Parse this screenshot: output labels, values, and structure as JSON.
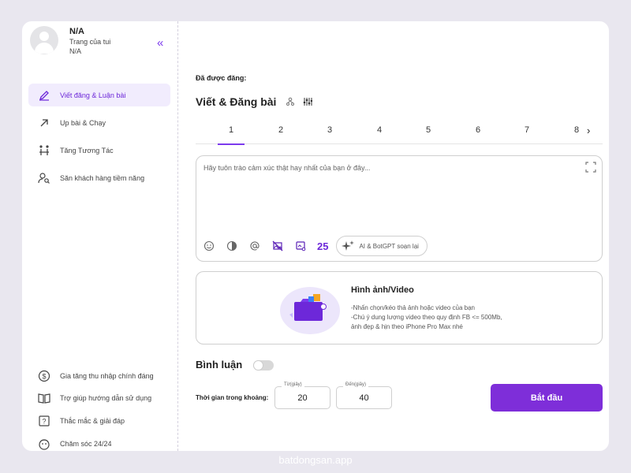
{
  "profile": {
    "name": "N/A",
    "subtitle": "Trang của tui",
    "id": "N/A"
  },
  "sidebar": {
    "items": [
      {
        "label": "Viết đăng & Luận bài",
        "icon": "pen-icon",
        "active": true
      },
      {
        "label": "Up bài & Chạy",
        "icon": "arrow-up-right-icon",
        "active": false
      },
      {
        "label": "Tăng Tương Tác",
        "icon": "interaction-icon",
        "active": false
      },
      {
        "label": "Săn khách hàng tiềm năng",
        "icon": "user-search-icon",
        "active": false
      }
    ],
    "bottom_items": [
      {
        "label": "Gia tăng thu nhập chính đáng",
        "icon": "dollar-icon"
      },
      {
        "label": "Trợ giúp hướng dẫn sử dụng",
        "icon": "book-icon"
      },
      {
        "label": "Thắc mắc & giải đáp",
        "icon": "question-icon"
      },
      {
        "label": "Chăm sóc 24/24",
        "icon": "support-icon"
      }
    ]
  },
  "main": {
    "posted_label": "Đã được đăng:",
    "title": "Viết & Đăng bài",
    "tabs": [
      "1",
      "2",
      "3",
      "4",
      "5",
      "6",
      "7",
      "8"
    ],
    "active_tab": "1",
    "editor": {
      "placeholder": "Hãy tuôn trào cảm xúc thật hay nhất của bạn ở đây...",
      "value": "",
      "count": "25",
      "ai_button": "AI & BotGPT soạn lại"
    },
    "media": {
      "title": "Hình ảnh/Video",
      "line1": "-Nhấn chọn/kéo thả ảnh hoặc video của bạn",
      "line2": "-Chú ý dung lượng video theo quy định FB <= 500Mb,",
      "line3": "ảnh đẹp & hịn theo iPhone Pro Max nhé"
    },
    "comment_label": "Bình luận",
    "comment_enabled": false,
    "time": {
      "label": "Thời gian trong khoảng:",
      "from_label": "Từ(giây)",
      "from_value": "20",
      "to_label": "Đến(giây)",
      "to_value": "40"
    },
    "start_button": "Bắt đầu"
  },
  "accent_color": "#7e2ed9",
  "watermark": "batdongsan.app"
}
